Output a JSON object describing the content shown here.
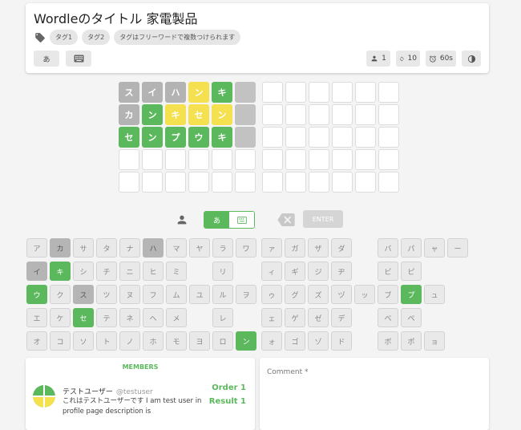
{
  "header": {
    "title": "Wordleのタイトル 家電製品",
    "tags": [
      "タグ1",
      "タグ2",
      "タグはフリーワードで複数つけられます"
    ],
    "tools": {
      "kana_label": "あ",
      "keyboard_icon": "keyboard-icon"
    },
    "stats": {
      "players": "1",
      "retries": "10",
      "time_limit": "60s"
    }
  },
  "board_left": [
    [
      {
        "c": "ス",
        "s": "gray"
      },
      {
        "c": "イ",
        "s": "gray"
      },
      {
        "c": "ハ",
        "s": "gray"
      },
      {
        "c": "ン",
        "s": "yellow"
      },
      {
        "c": "キ",
        "s": "green"
      },
      {
        "c": "",
        "s": "dark"
      }
    ],
    [
      {
        "c": "カ",
        "s": "gray"
      },
      {
        "c": "ン",
        "s": "green"
      },
      {
        "c": "キ",
        "s": "yellow"
      },
      {
        "c": "セ",
        "s": "yellow"
      },
      {
        "c": "ン",
        "s": "yellow"
      },
      {
        "c": "",
        "s": "dark"
      }
    ],
    [
      {
        "c": "セ",
        "s": "green"
      },
      {
        "c": "ン",
        "s": "green"
      },
      {
        "c": "プ",
        "s": "green"
      },
      {
        "c": "ウ",
        "s": "green"
      },
      {
        "c": "キ",
        "s": "green"
      },
      {
        "c": "",
        "s": "dark"
      }
    ],
    [
      {
        "c": "",
        "s": "empty"
      },
      {
        "c": "",
        "s": "empty"
      },
      {
        "c": "",
        "s": "empty"
      },
      {
        "c": "",
        "s": "empty"
      },
      {
        "c": "",
        "s": "empty"
      },
      {
        "c": "",
        "s": "empty"
      }
    ],
    [
      {
        "c": "",
        "s": "empty"
      },
      {
        "c": "",
        "s": "empty"
      },
      {
        "c": "",
        "s": "empty"
      },
      {
        "c": "",
        "s": "empty"
      },
      {
        "c": "",
        "s": "empty"
      },
      {
        "c": "",
        "s": "empty"
      }
    ]
  ],
  "board_right_rows": 5,
  "board_right_cols": 6,
  "controls": {
    "kana_mode": "あ",
    "enter_label": "ENTER"
  },
  "keyboard": {
    "left": [
      [
        {
          "c": "ア",
          "s": "n"
        },
        {
          "c": "カ",
          "s": "gray"
        },
        {
          "c": "サ",
          "s": "n"
        },
        {
          "c": "タ",
          "s": "n"
        },
        {
          "c": "ナ",
          "s": "n"
        },
        {
          "c": "ハ",
          "s": "gray"
        },
        {
          "c": "マ",
          "s": "n"
        },
        {
          "c": "ヤ",
          "s": "n"
        },
        {
          "c": "ラ",
          "s": "n"
        },
        {
          "c": "ワ",
          "s": "n"
        }
      ],
      [
        {
          "c": "イ",
          "s": "gray"
        },
        {
          "c": "キ",
          "s": "green"
        },
        {
          "c": "シ",
          "s": "n"
        },
        {
          "c": "チ",
          "s": "n"
        },
        {
          "c": "ニ",
          "s": "n"
        },
        {
          "c": "ヒ",
          "s": "n"
        },
        {
          "c": "ミ",
          "s": "n"
        },
        {
          "c": "",
          "s": "none"
        },
        {
          "c": "リ",
          "s": "n"
        },
        {
          "c": "",
          "s": "none"
        }
      ],
      [
        {
          "c": "ウ",
          "s": "green"
        },
        {
          "c": "ク",
          "s": "n"
        },
        {
          "c": "ス",
          "s": "gray"
        },
        {
          "c": "ツ",
          "s": "n"
        },
        {
          "c": "ヌ",
          "s": "n"
        },
        {
          "c": "フ",
          "s": "n"
        },
        {
          "c": "ム",
          "s": "n"
        },
        {
          "c": "ユ",
          "s": "n"
        },
        {
          "c": "ル",
          "s": "n"
        },
        {
          "c": "ヲ",
          "s": "n"
        }
      ],
      [
        {
          "c": "エ",
          "s": "n"
        },
        {
          "c": "ケ",
          "s": "n"
        },
        {
          "c": "セ",
          "s": "green"
        },
        {
          "c": "テ",
          "s": "n"
        },
        {
          "c": "ネ",
          "s": "n"
        },
        {
          "c": "ヘ",
          "s": "n"
        },
        {
          "c": "メ",
          "s": "n"
        },
        {
          "c": "",
          "s": "none"
        },
        {
          "c": "レ",
          "s": "n"
        },
        {
          "c": "",
          "s": "none"
        }
      ],
      [
        {
          "c": "オ",
          "s": "n"
        },
        {
          "c": "コ",
          "s": "n"
        },
        {
          "c": "ソ",
          "s": "n"
        },
        {
          "c": "ト",
          "s": "n"
        },
        {
          "c": "ノ",
          "s": "n"
        },
        {
          "c": "ホ",
          "s": "n"
        },
        {
          "c": "モ",
          "s": "n"
        },
        {
          "c": "ヨ",
          "s": "n"
        },
        {
          "c": "ロ",
          "s": "n"
        },
        {
          "c": "ン",
          "s": "green"
        }
      ]
    ],
    "right": [
      [
        {
          "c": "ァ",
          "s": "n"
        },
        {
          "c": "ガ",
          "s": "n"
        },
        {
          "c": "ザ",
          "s": "n"
        },
        {
          "c": "ダ",
          "s": "n"
        },
        {
          "c": "",
          "s": "none"
        },
        {
          "c": "バ",
          "s": "n"
        },
        {
          "c": "パ",
          "s": "n"
        },
        {
          "c": "ャ",
          "s": "n"
        },
        {
          "c": "ー",
          "s": "n"
        }
      ],
      [
        {
          "c": "ィ",
          "s": "n"
        },
        {
          "c": "ギ",
          "s": "n"
        },
        {
          "c": "ジ",
          "s": "n"
        },
        {
          "c": "ヂ",
          "s": "n"
        },
        {
          "c": "",
          "s": "none"
        },
        {
          "c": "ビ",
          "s": "n"
        },
        {
          "c": "ピ",
          "s": "n"
        },
        {
          "c": "",
          "s": "none"
        },
        {
          "c": "",
          "s": "none"
        }
      ],
      [
        {
          "c": "ゥ",
          "s": "n"
        },
        {
          "c": "グ",
          "s": "n"
        },
        {
          "c": "ズ",
          "s": "n"
        },
        {
          "c": "ヅ",
          "s": "n"
        },
        {
          "c": "ッ",
          "s": "n"
        },
        {
          "c": "ブ",
          "s": "n"
        },
        {
          "c": "プ",
          "s": "green"
        },
        {
          "c": "ュ",
          "s": "n"
        },
        {
          "c": "",
          "s": "none"
        }
      ],
      [
        {
          "c": "ェ",
          "s": "n"
        },
        {
          "c": "ゲ",
          "s": "n"
        },
        {
          "c": "ゼ",
          "s": "n"
        },
        {
          "c": "デ",
          "s": "n"
        },
        {
          "c": "",
          "s": "none"
        },
        {
          "c": "ベ",
          "s": "n"
        },
        {
          "c": "ペ",
          "s": "n"
        },
        {
          "c": "",
          "s": "none"
        },
        {
          "c": "",
          "s": "none"
        }
      ],
      [
        {
          "c": "ォ",
          "s": "n"
        },
        {
          "c": "ゴ",
          "s": "n"
        },
        {
          "c": "ゾ",
          "s": "n"
        },
        {
          "c": "ド",
          "s": "n"
        },
        {
          "c": "",
          "s": "none"
        },
        {
          "c": "ボ",
          "s": "n"
        },
        {
          "c": "ポ",
          "s": "n"
        },
        {
          "c": "ョ",
          "s": "n"
        },
        {
          "c": "",
          "s": "none"
        }
      ]
    ]
  },
  "members": {
    "title": "MEMBERS",
    "name": "テストユーザー",
    "handle": "@testuser",
    "description": "これはテストユーザーです I am test user in profile page description is",
    "order": "Order 1",
    "result": "Result 1"
  },
  "comment": {
    "label": "Comment *"
  }
}
